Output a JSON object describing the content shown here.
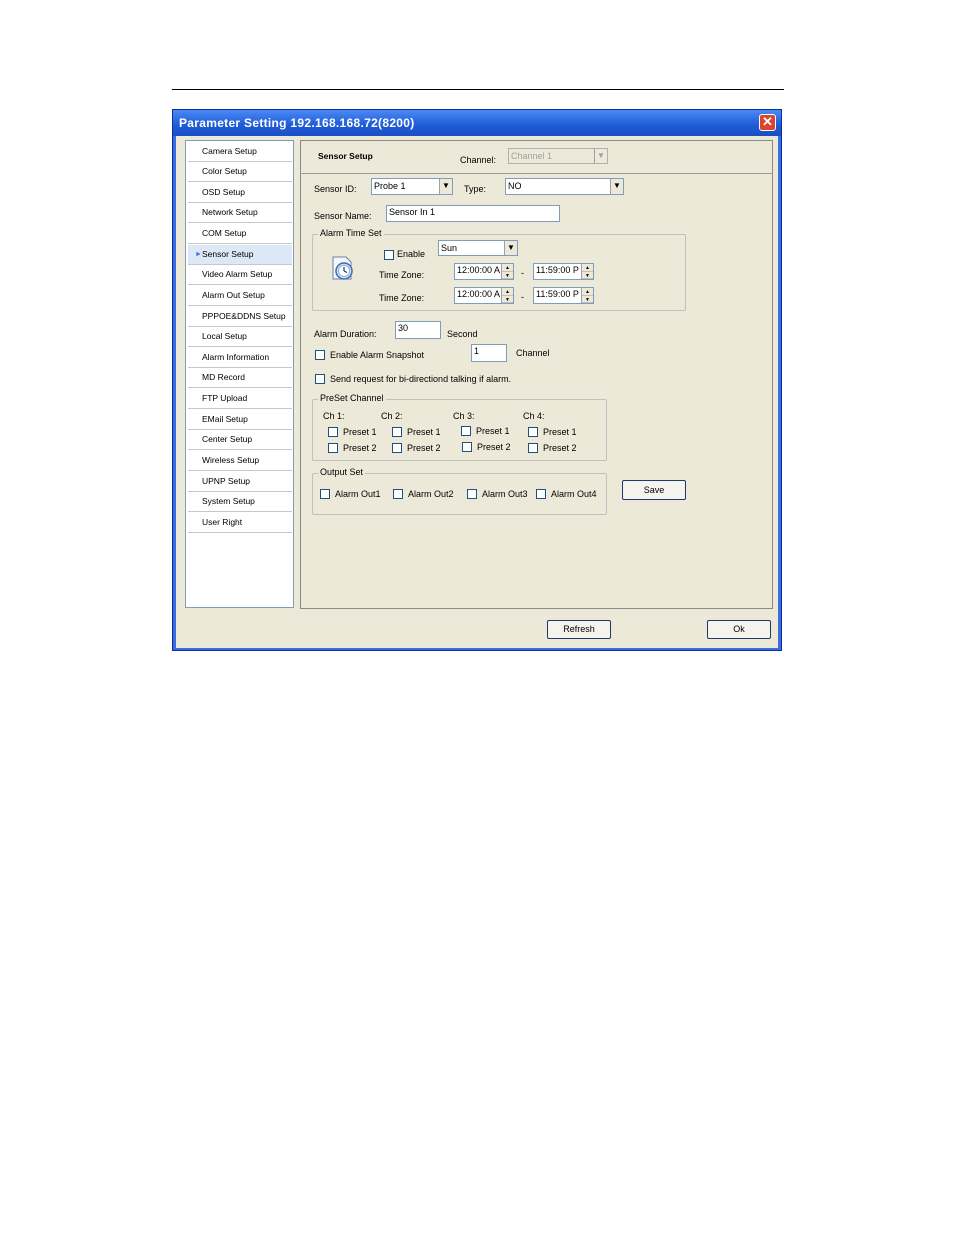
{
  "window": {
    "title": "Parameter Setting 192.168.168.72(8200)",
    "close_glyph": "✕"
  },
  "sidebar": {
    "active": "Sensor Setup",
    "items": [
      "Camera Setup",
      "Color Setup",
      "OSD Setup",
      "Network Setup",
      "COM Setup",
      "Sensor Setup",
      "Video Alarm Setup",
      "Alarm Out Setup",
      "PPPOE&DDNS Setup",
      "Local Setup",
      "Alarm Information",
      "MD Record",
      "FTP Upload",
      "EMail Setup",
      "Center Setup",
      "Wireless Setup",
      "UPNP Setup",
      "System Setup",
      "User Right"
    ]
  },
  "header": {
    "title": "Sensor Setup",
    "channel_label": "Channel:",
    "channel_value": "Channel 1"
  },
  "sensor": {
    "id_label": "Sensor ID:",
    "id_value": "Probe 1",
    "type_label": "Type:",
    "type_value": "NO",
    "name_label": "Sensor Name:",
    "name_value": "Sensor In 1"
  },
  "alarm_time": {
    "group_title": "Alarm Time Set",
    "enable_label": "Enable",
    "day_value": "Sun",
    "icon": "clock-icon",
    "zones": [
      {
        "label": "Time Zone:",
        "start": "12:00:00 A",
        "dash": "-",
        "end": "11:59:00 P"
      },
      {
        "label": "Time Zone:",
        "start": "12:00:00 A",
        "dash": "-",
        "end": "11:59:00 P"
      }
    ]
  },
  "alarm": {
    "duration_label": "Alarm Duration:",
    "duration_value": "30",
    "duration_unit": "Second",
    "snapshot_label": "Enable Alarm Snapshot",
    "snapshot_channel_value": "1",
    "snapshot_channel_unit": "Channel",
    "bidirectional_label": "Send request for bi-directiond talking if alarm."
  },
  "preset": {
    "group_title": "PreSet Channel",
    "channels": [
      {
        "label": "Ch 1:",
        "p1": "Preset 1",
        "p2": "Preset 2"
      },
      {
        "label": "Ch 2:",
        "p1": "Preset 1",
        "p2": "Preset 2"
      },
      {
        "label": "Ch 3:",
        "p1": "Preset 1",
        "p2": "Preset 2"
      },
      {
        "label": "Ch 4:",
        "p1": "Preset 1",
        "p2": "Preset 2"
      }
    ]
  },
  "output": {
    "group_title": "Output Set",
    "items": [
      "Alarm Out1",
      "Alarm Out2",
      "Alarm Out3",
      "Alarm Out4"
    ]
  },
  "buttons": {
    "save": "Save",
    "refresh": "Refresh",
    "ok": "Ok"
  },
  "glyphs": {
    "dropdown": "▼",
    "spin_up": "▲",
    "spin_down": "▼",
    "nav_arrow": "►"
  }
}
